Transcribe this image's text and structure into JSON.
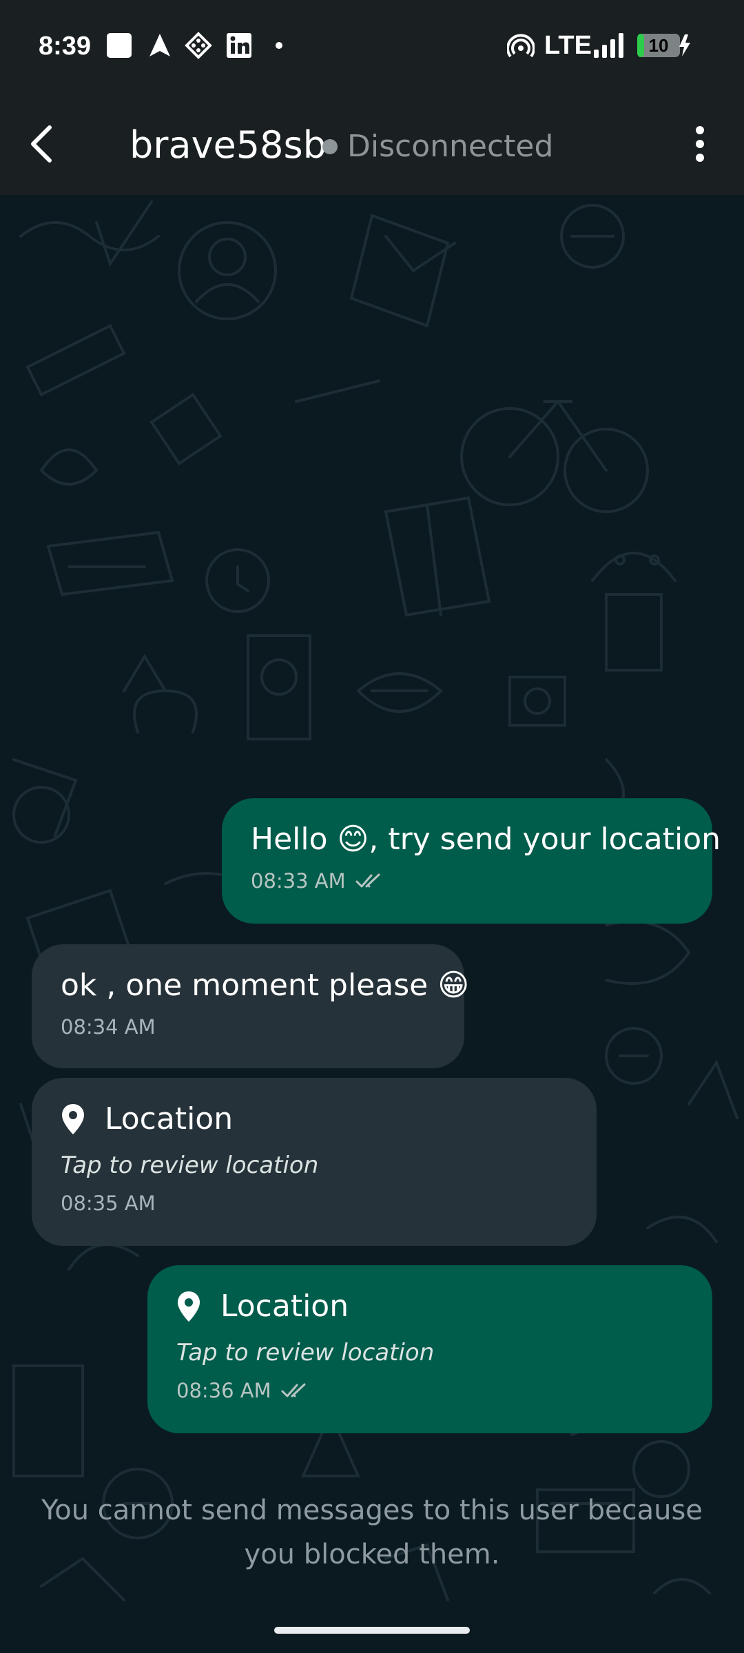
{
  "status_bar": {
    "time": "8:39",
    "network": "LTE",
    "battery_level": "10",
    "icons": [
      "app-square-icon",
      "navigation-arrow-icon",
      "game-icon",
      "linkedin-icon",
      "dot-icon",
      "hotspot-icon",
      "signal-icon",
      "battery-charging-icon"
    ]
  },
  "header": {
    "contact_name": "brave58sb",
    "presence": "Disconnected",
    "icons": [
      "back-arrow-icon",
      "more-vert-icon"
    ]
  },
  "messages": [
    {
      "direction": "outgoing",
      "type": "text",
      "text_before": "Hello ",
      "emoji": "😊",
      "text_after": ", try send your location",
      "time": "08:33 AM",
      "status": "read-double-check"
    },
    {
      "direction": "incoming",
      "type": "text",
      "text_before": "ok , one moment please ",
      "emoji": "😁",
      "text_after": "",
      "time": "08:34 AM"
    },
    {
      "direction": "incoming",
      "type": "location",
      "title": "Location",
      "subtitle": "Tap to review location",
      "time": "08:35 AM"
    },
    {
      "direction": "outgoing",
      "type": "location",
      "title": "Location",
      "subtitle": "Tap to review location",
      "time": "08:36 AM",
      "status": "read-double-check"
    }
  ],
  "footer": {
    "blocked_notice": "You cannot send messages to this user because you blocked them."
  },
  "colors": {
    "outgoing_bubble": "#005c4b",
    "incoming_bubble": "#263239",
    "background": "#0b1a21",
    "app_bar": "#1a1f22"
  }
}
